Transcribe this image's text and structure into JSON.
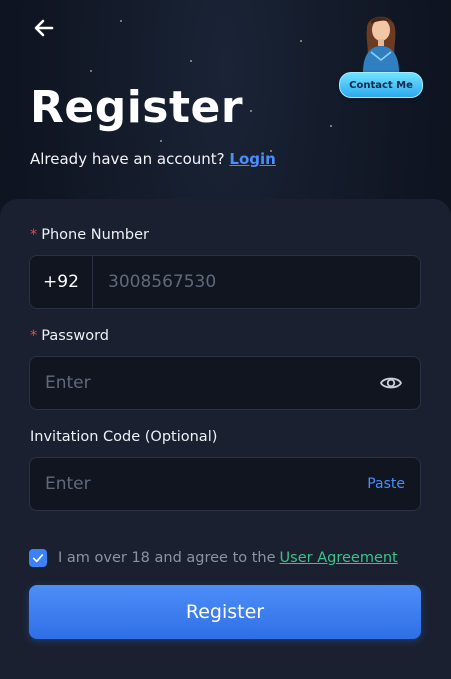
{
  "header": {
    "back_icon": "arrow-left-icon",
    "contact_label": "Contact Me",
    "title": "Register",
    "have_account_text": "Already have an account?",
    "login_link": "Login"
  },
  "form": {
    "phone": {
      "label": "Phone Number",
      "country_code": "+92",
      "placeholder": "3008567530",
      "value": ""
    },
    "password": {
      "label": "Password",
      "placeholder": "Enter",
      "value": "",
      "toggle_icon": "eye-icon"
    },
    "invitation": {
      "label": "Invitation Code (Optional)",
      "placeholder": "Enter",
      "value": "",
      "paste_label": "Paste"
    },
    "agreement": {
      "checked": true,
      "text": "I am over 18 and agree to the",
      "link": "User Agreement"
    },
    "submit_label": "Register"
  },
  "colors": {
    "accent": "#3a82f6",
    "link": "#4b8dff",
    "agreement_link": "#39c38a",
    "required": "#e24b4b",
    "contact_button": "#2ea8ee"
  }
}
